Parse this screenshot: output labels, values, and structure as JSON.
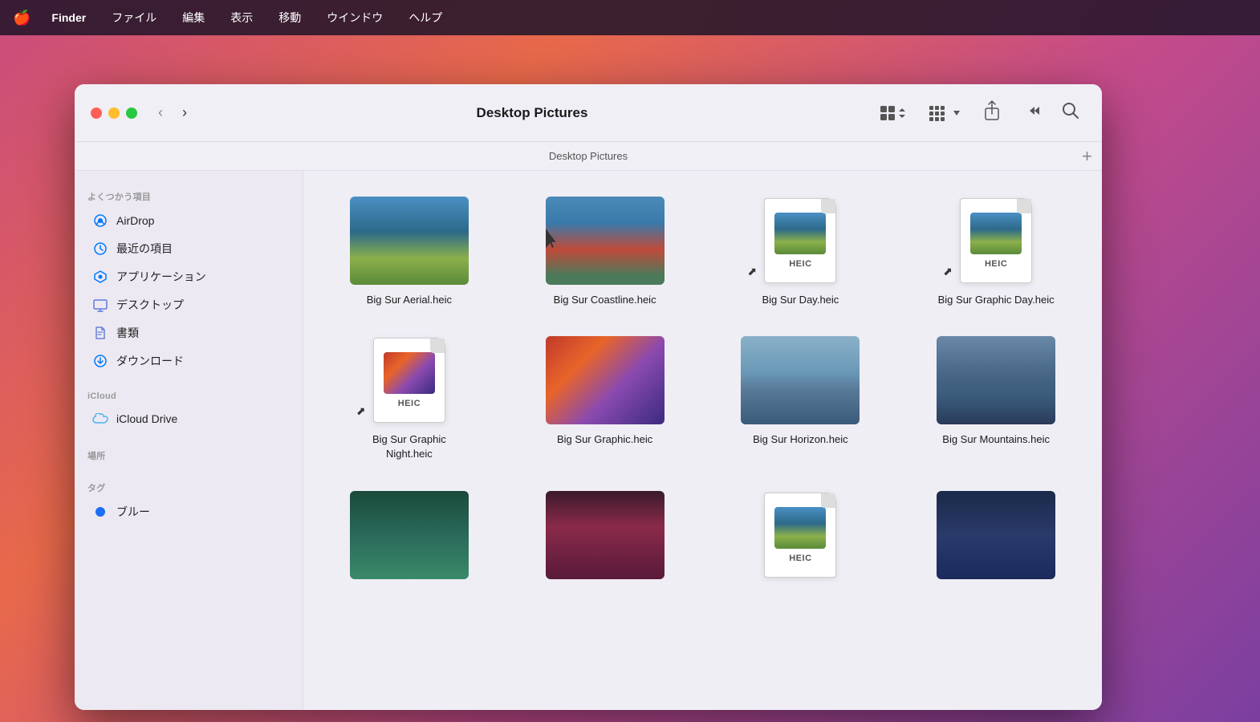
{
  "menubar": {
    "apple": "🍎",
    "items": [
      "Finder",
      "ファイル",
      "編集",
      "表示",
      "移動",
      "ウインドウ",
      "ヘルプ"
    ]
  },
  "window": {
    "title": "Desktop Pictures",
    "breadcrumb": "Desktop Pictures"
  },
  "sidebar": {
    "favorites_label": "よくつかう項目",
    "icloud_label": "iCloud",
    "places_label": "場所",
    "tags_label": "タグ",
    "items": [
      {
        "id": "airdrop",
        "label": "AirDrop"
      },
      {
        "id": "recents",
        "label": "最近の項目"
      },
      {
        "id": "applications",
        "label": "アプリケーション"
      },
      {
        "id": "desktop",
        "label": "デスクトップ"
      },
      {
        "id": "documents",
        "label": "書類"
      },
      {
        "id": "downloads",
        "label": "ダウンロード"
      }
    ],
    "icloud_items": [
      {
        "id": "icloud-drive",
        "label": "iCloud Drive"
      }
    ],
    "tags": [
      {
        "id": "blue",
        "label": "ブルー"
      }
    ]
  },
  "files": [
    {
      "id": "file-1",
      "name": "Big Sur Aerial.heic",
      "type": "image",
      "thumb_class": "thumb-aerial"
    },
    {
      "id": "file-2",
      "name": "Big Sur Coastline.heic",
      "type": "image",
      "thumb_class": "thumb-coastline"
    },
    {
      "id": "file-3",
      "name": "Big Sur Day.heic",
      "type": "heic",
      "thumb_class": "thumb-day",
      "preview_class": "thumb-aerial"
    },
    {
      "id": "file-4",
      "name": "Big Sur Graphic Day.heic",
      "type": "heic",
      "thumb_class": "thumb-graphic-day",
      "preview_class": "thumb-aerial"
    },
    {
      "id": "file-5",
      "name": "Big Sur Graphic Night.heic",
      "type": "heic",
      "thumb_class": "thumb-graphic-night",
      "preview_class": "thumb-graphic"
    },
    {
      "id": "file-6",
      "name": "Big Sur Graphic.heic",
      "type": "image",
      "thumb_class": "thumb-graphic"
    },
    {
      "id": "file-7",
      "name": "Big Sur Horizon.heic",
      "type": "image",
      "thumb_class": "thumb-horizon"
    },
    {
      "id": "file-8",
      "name": "Big Sur Mountains.heic",
      "type": "image",
      "thumb_class": "thumb-mountains"
    },
    {
      "id": "file-9",
      "name": "",
      "type": "image",
      "thumb_class": "thumb-3a"
    },
    {
      "id": "file-10",
      "name": "",
      "type": "image",
      "thumb_class": "thumb-3b"
    },
    {
      "id": "file-11",
      "name": "",
      "type": "heic",
      "thumb_class": "thumb-3c",
      "preview_class": "thumb-aerial"
    },
    {
      "id": "file-12",
      "name": "",
      "type": "image",
      "thumb_class": "thumb-3d"
    }
  ],
  "buttons": {
    "back": "‹",
    "forward": "›",
    "share": "⬆",
    "more": "≫",
    "search": "🔍",
    "add": "+"
  }
}
